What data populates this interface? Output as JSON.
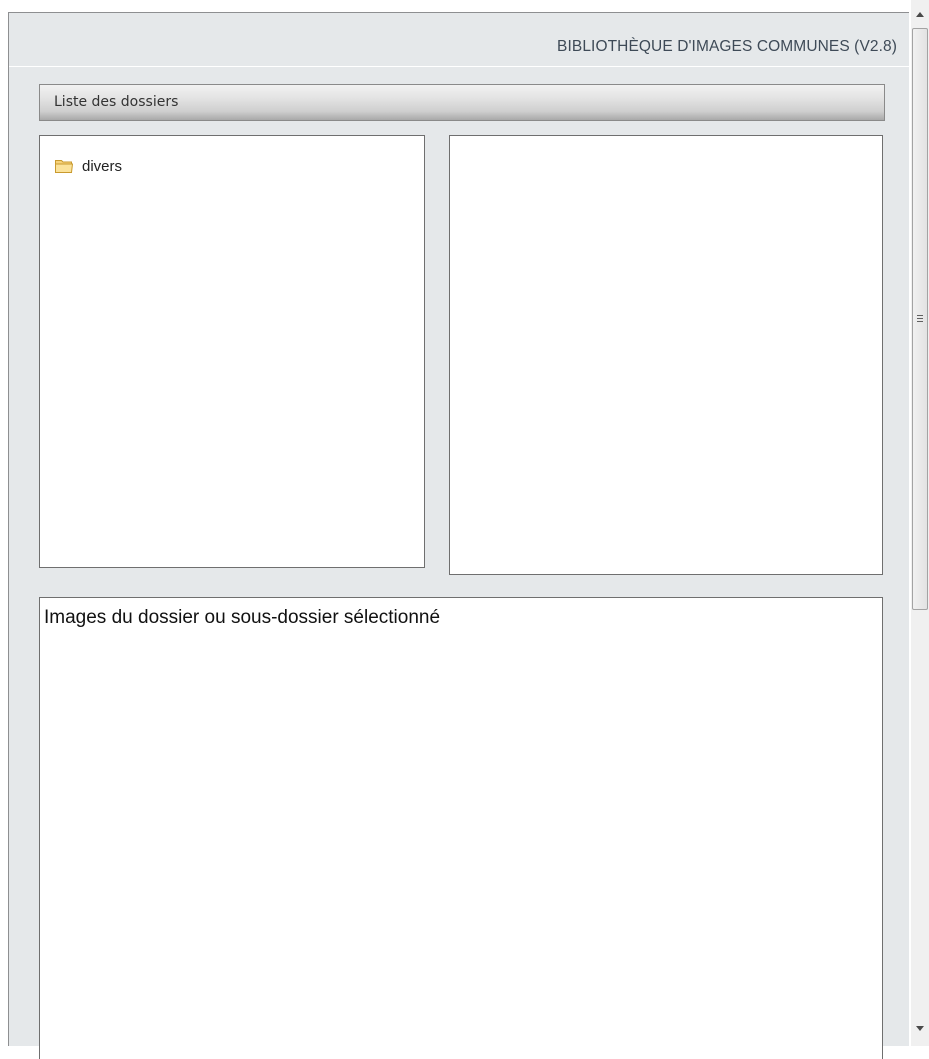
{
  "window": {
    "title": "BIBLIOTHÈQUE D'IMAGES COMMUNES (V2.8)"
  },
  "folder_section": {
    "header": "Liste des dossiers",
    "folders": [
      {
        "label": "divers",
        "icon": "folder-icon"
      }
    ]
  },
  "subfolder_panel": {
    "items": []
  },
  "images_panel": {
    "heading": "Images du dossier ou sous-dossier sélectionné"
  },
  "colors": {
    "window_background": "#e5e8ea",
    "header_bar": "#cfcfcf",
    "folder_icon": "#f2c14e",
    "title_text": "#3e4a57"
  },
  "scrollbar": {
    "icons": [
      "arrow-up-icon",
      "arrow-down-icon",
      "grip-icon"
    ]
  }
}
